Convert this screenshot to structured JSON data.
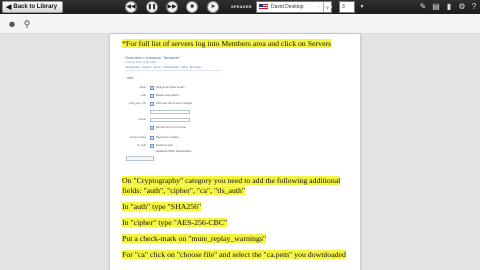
{
  "toolbar": {
    "back_label": "Back to Library",
    "speaker_label": "SPEAKER",
    "voice_value": "David Desktop",
    "speed_label": "SPEED",
    "speed_value": "3"
  },
  "embedded_screenshot": {
    "title": "Overview » Instance \"listname\"",
    "subtitle": "« back to basic config editor",
    "menu": "Configuration · Instance · Server · Authentication · VPNs · Encryption",
    "heading": "VPN",
    "rows": [
      {
        "label": "cipher",
        "type": "check",
        "text": "Change the cipher & auth"
      },
      {
        "label": "auth",
        "type": "check",
        "text": "Enable extra options"
      },
      {
        "label": "push_peer_info",
        "type": "check",
        "text": "Push peer info to server settings"
      },
      {
        "label": "",
        "type": "input",
        "text": ""
      },
      {
        "label": "remote",
        "type": "input",
        "text": ""
      },
      {
        "label": "",
        "type": "check",
        "text": "Remote host or ip of server"
      },
      {
        "label": "connect-retries",
        "type": "check",
        "text": "Reconnect on failure"
      },
      {
        "label": "tls_auth",
        "type": "check",
        "text": "Enable tls-auth"
      },
      {
        "label": "",
        "type": "check",
        "text": "Additional HMAC authentication"
      }
    ]
  },
  "document": {
    "lines": [
      {
        "text": "*For full list of servers log into Members area and click on Servers",
        "highlight": true
      },
      {
        "text": "On \"Cryptography\" category you need to add the following additional",
        "highlight": true
      },
      {
        "text": "fields: \"auth\", \"cipher\", \"ca\", \"tls_auth\"",
        "highlight": true
      },
      {
        "text": "In \"auth\" type \"SHA256\"",
        "highlight": true
      },
      {
        "text": "In \"cipher\" type \"AES-256-CBC\"",
        "highlight": true
      },
      {
        "text": "Put a check-mark on \"mute_replay_warnings\"",
        "highlight": true
      },
      {
        "text": "For \"ca\" click on \"choose file\" and select the \"ca.pem\" you downloaded",
        "highlight": true
      }
    ]
  }
}
